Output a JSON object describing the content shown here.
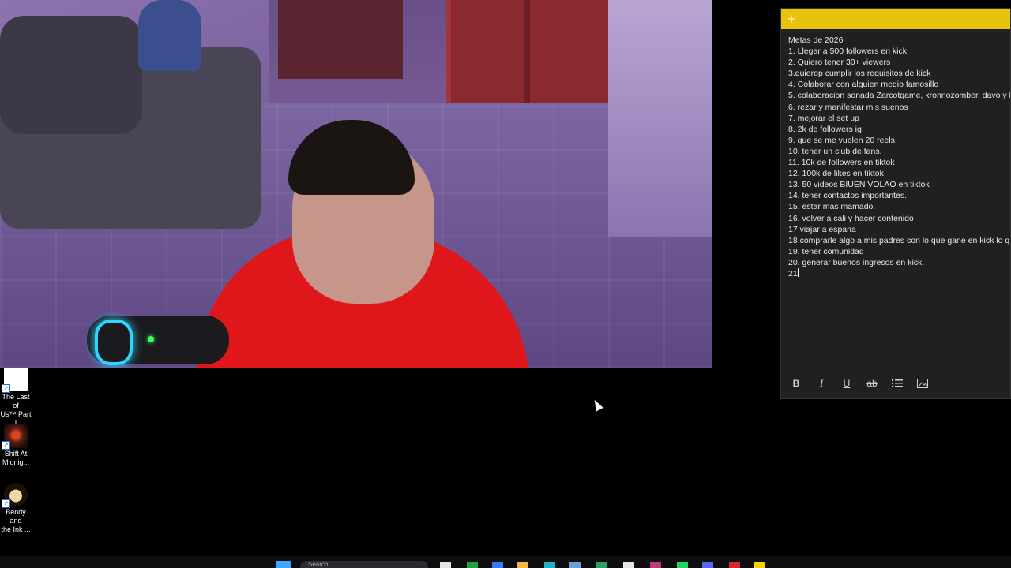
{
  "sticky_note": {
    "title": "Metas de 2026",
    "lines": [
      "1. Llegar a 500 followers en kick",
      "2. Quiero tener 30+ viewers",
      "3.quierop cumplir los requisitos de kick",
      "4. Colaborar con alguien medio famosillo",
      "5. colaboracion sonada Zarcotgame, kronnozomber, davo y l",
      "6. rezar y manifestar mis suenos",
      "7. mejorar el set up",
      "8. 2k de followers ig",
      "9. que se me vuelen 20 reels.",
      "10. tener un club de fans.",
      "11. 10k de followers en tiktok",
      "12. 100k de likes en tiktok",
      "13. 50 videos BIUEN VOLAO en tiktok",
      "14. tener contactos importantes.",
      "15. estar mas mamado.",
      "16. volver a cali y hacer contenido",
      "17 viajar a espana",
      "18 comprarle algo a mis padres con lo que gane en kick lo q",
      "19. tener comunidad",
      "20. generar buenos ingresos en kick."
    ],
    "current_line": "21",
    "new_note_icon": "plus-icon",
    "toolbar": {
      "bold": "B",
      "italic": "I",
      "underline": "U",
      "strikethrough": "ab"
    },
    "header_color": "#e8c30d",
    "body_color": "#202020"
  },
  "desktop_icons": [
    {
      "label_line1": "The Last of",
      "label_line2": "Us™ Part I"
    },
    {
      "label_line1": "Shift At",
      "label_line2": "Midnig..."
    },
    {
      "label_line1": "Bendy and",
      "label_line2": "the Ink ..."
    }
  ],
  "taskbar": {
    "search_placeholder": "Search"
  }
}
